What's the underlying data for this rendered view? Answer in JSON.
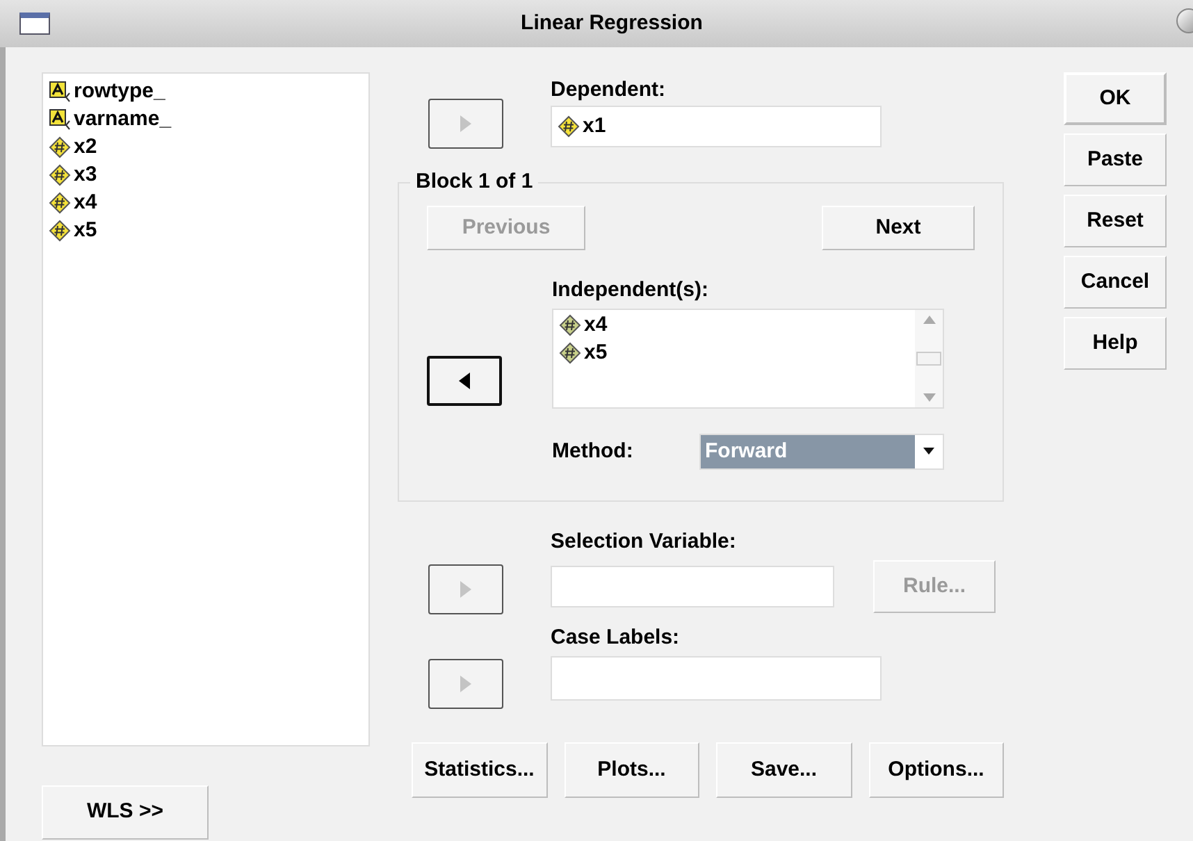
{
  "window": {
    "title": "Linear Regression"
  },
  "source_variables": [
    {
      "name": "rowtype_",
      "kind": "string"
    },
    {
      "name": "varname_",
      "kind": "string"
    },
    {
      "name": "x2",
      "kind": "numeric"
    },
    {
      "name": "x3",
      "kind": "numeric"
    },
    {
      "name": "x4",
      "kind": "numeric"
    },
    {
      "name": "x5",
      "kind": "numeric"
    }
  ],
  "dependent": {
    "label": "Dependent:",
    "arrow": {
      "kind": "right",
      "disabled": true
    },
    "variables": [
      {
        "name": "x1",
        "kind": "numeric"
      }
    ]
  },
  "block": {
    "title": "Block 1 of 1",
    "previous": {
      "label": "Previous",
      "disabled": true
    },
    "next": {
      "label": "Next",
      "disabled": false
    },
    "independents": {
      "label": "Independent(s):",
      "arrow": {
        "kind": "left",
        "disabled": false
      },
      "variables": [
        {
          "name": "x4",
          "kind": "numeric"
        },
        {
          "name": "x5",
          "kind": "numeric"
        }
      ]
    },
    "method": {
      "label": "Method:",
      "value": "Forward"
    }
  },
  "selection_variable": {
    "label": "Selection Variable:",
    "arrow": {
      "kind": "right",
      "disabled": true
    },
    "rule": {
      "label": "Rule...",
      "disabled": true
    }
  },
  "case_labels": {
    "label": "Case Labels:",
    "arrow": {
      "kind": "right",
      "disabled": true
    }
  },
  "side_buttons": [
    {
      "label": "OK",
      "default": true
    },
    {
      "label": "Paste",
      "default": false
    },
    {
      "label": "Reset",
      "default": false
    },
    {
      "label": "Cancel",
      "default": false
    },
    {
      "label": "Help",
      "default": false
    }
  ],
  "wls_button": {
    "label": "WLS >>"
  },
  "bottom_buttons": [
    {
      "label": "Statistics..."
    },
    {
      "label": "Plots..."
    },
    {
      "label": "Save..."
    },
    {
      "label": "Options..."
    }
  ]
}
